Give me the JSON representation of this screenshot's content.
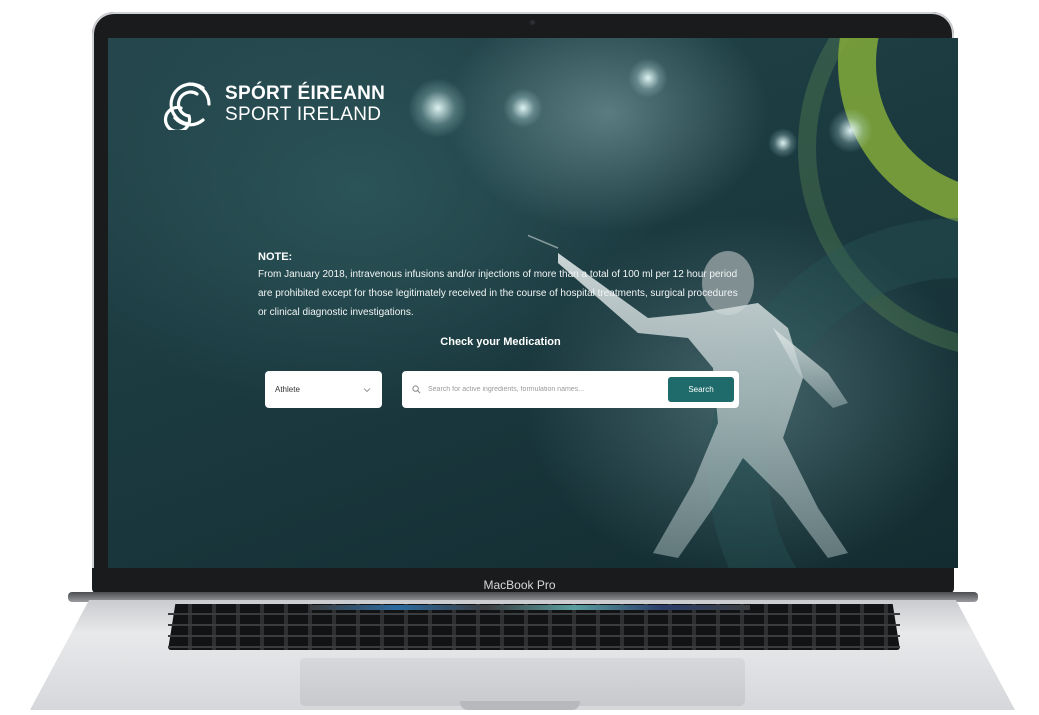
{
  "device": {
    "model_label": "MacBook Pro"
  },
  "brand": {
    "name_irish": "SPÓRT ÉIREANN",
    "name_english": "SPORT IRELAND",
    "logo_icon": "spiral-s-logo"
  },
  "note": {
    "heading": "NOTE:",
    "body": "From January 2018, intravenous infusions and/or injections of more than a total of 100 ml per 12 hour period are prohibited except for those legitimately received in the course of hospital treatments, surgical procedures or clinical diagnostic investigations."
  },
  "check": {
    "title": "Check your Medication",
    "role_select": {
      "selected": "Athlete",
      "icon": "chevron-down-icon"
    },
    "search": {
      "placeholder": "Search for active ingredients, formulation names...",
      "icon": "search-icon",
      "button_label": "Search"
    }
  },
  "colors": {
    "background": "#1b3a40",
    "accent_green": "#7da43a",
    "button_teal": "#1f6b6b",
    "text_white": "#ffffff"
  }
}
